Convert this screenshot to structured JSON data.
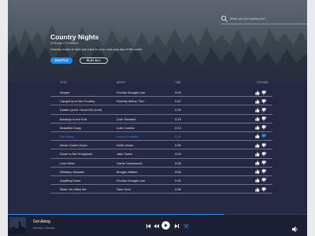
{
  "search": {
    "placeholder": "What are you looking for?"
  },
  "playlist": {
    "title": "Country Nights",
    "meta": "18 Songs   •   4 Followers",
    "description": "Country music to take you back to your roots any day of the week.",
    "shuffle_label": "SHUFFLE",
    "play_all_label": "PLAY ALL"
  },
  "table": {
    "headers": {
      "title": "TITLE",
      "artist": "ARTIST",
      "time": "TIME",
      "options": "OPTIONS"
    },
    "rows": [
      {
        "title": "Simple",
        "artist": "Florida Georgia Line",
        "time": "3:05"
      },
      {
        "title": "Caught up in the Country",
        "artist": "Rodney Atkins, The...",
        "time": "2:41"
      },
      {
        "title": "Dustin Lynch: Good Girl (Live)",
        "artist": "",
        "time": "3:26"
      },
      {
        "title": "Breakup in the End",
        "artist": "Cole Swindell",
        "time": "3:19"
      },
      {
        "title": "Beautiful Crazy",
        "artist": "Luke Combs",
        "time": "3:13"
      },
      {
        "title": "Get Along",
        "artist": "Kenny Chesney",
        "time": "3:31",
        "active": true
      },
      {
        "title": "Never Comin Down",
        "artist": "Keith Urban",
        "time": "3:35"
      },
      {
        "title": "Down to the Honkytonk",
        "artist": "Jake Owen",
        "time": "3:03"
      },
      {
        "title": "Love Wins",
        "artist": "Carrie Underwood",
        "time": "3:26"
      },
      {
        "title": "Whiskey Glasses",
        "artist": "Morgan Wallen",
        "time": "3:54"
      },
      {
        "title": "Anything Goes",
        "artist": "Florida Georgia Line",
        "time": "3:32"
      },
      {
        "title": "Make You Miss Me",
        "artist": "Sam Hunt",
        "time": "3:46"
      }
    ]
  },
  "now_playing": {
    "title": "Get Along",
    "artist": "Kenney Chesney",
    "progress": 0.72
  },
  "colors": {
    "accent": "#2f8ff2",
    "background": "#252842",
    "player": "#1d1f33"
  }
}
